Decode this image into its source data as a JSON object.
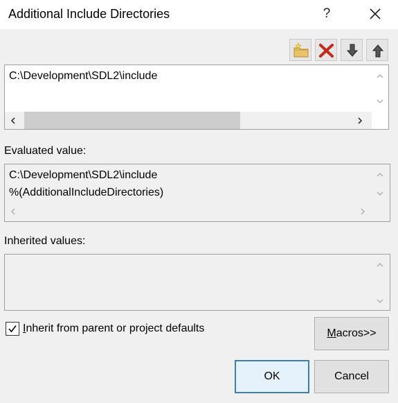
{
  "window": {
    "title": "Additional Include Directories",
    "help_glyph": "?"
  },
  "toolbar": {
    "buttons": [
      {
        "name": "new-line",
        "icon": "new-folder-icon"
      },
      {
        "name": "delete",
        "icon": "delete-x-icon"
      },
      {
        "name": "move-down",
        "icon": "arrow-down-icon"
      },
      {
        "name": "move-up",
        "icon": "arrow-up-icon"
      }
    ]
  },
  "editor": {
    "lines": [
      "C:\\Development\\SDL2\\include"
    ]
  },
  "evaluated": {
    "label": "Evaluated value:",
    "lines": [
      "C:\\Development\\SDL2\\include",
      "%(AdditionalIncludeDirectories)"
    ]
  },
  "inherited": {
    "label": "Inherited values:",
    "lines": []
  },
  "inherit_checkbox": {
    "label": "Inherit from parent or project defaults",
    "checked": true
  },
  "buttons": {
    "macros": "Macros>>",
    "ok": "OK",
    "cancel": "Cancel"
  },
  "colors": {
    "accent": "#3c7fb1",
    "delete_red": "#c42b1c",
    "folder_yellow": "#e8c36a"
  }
}
